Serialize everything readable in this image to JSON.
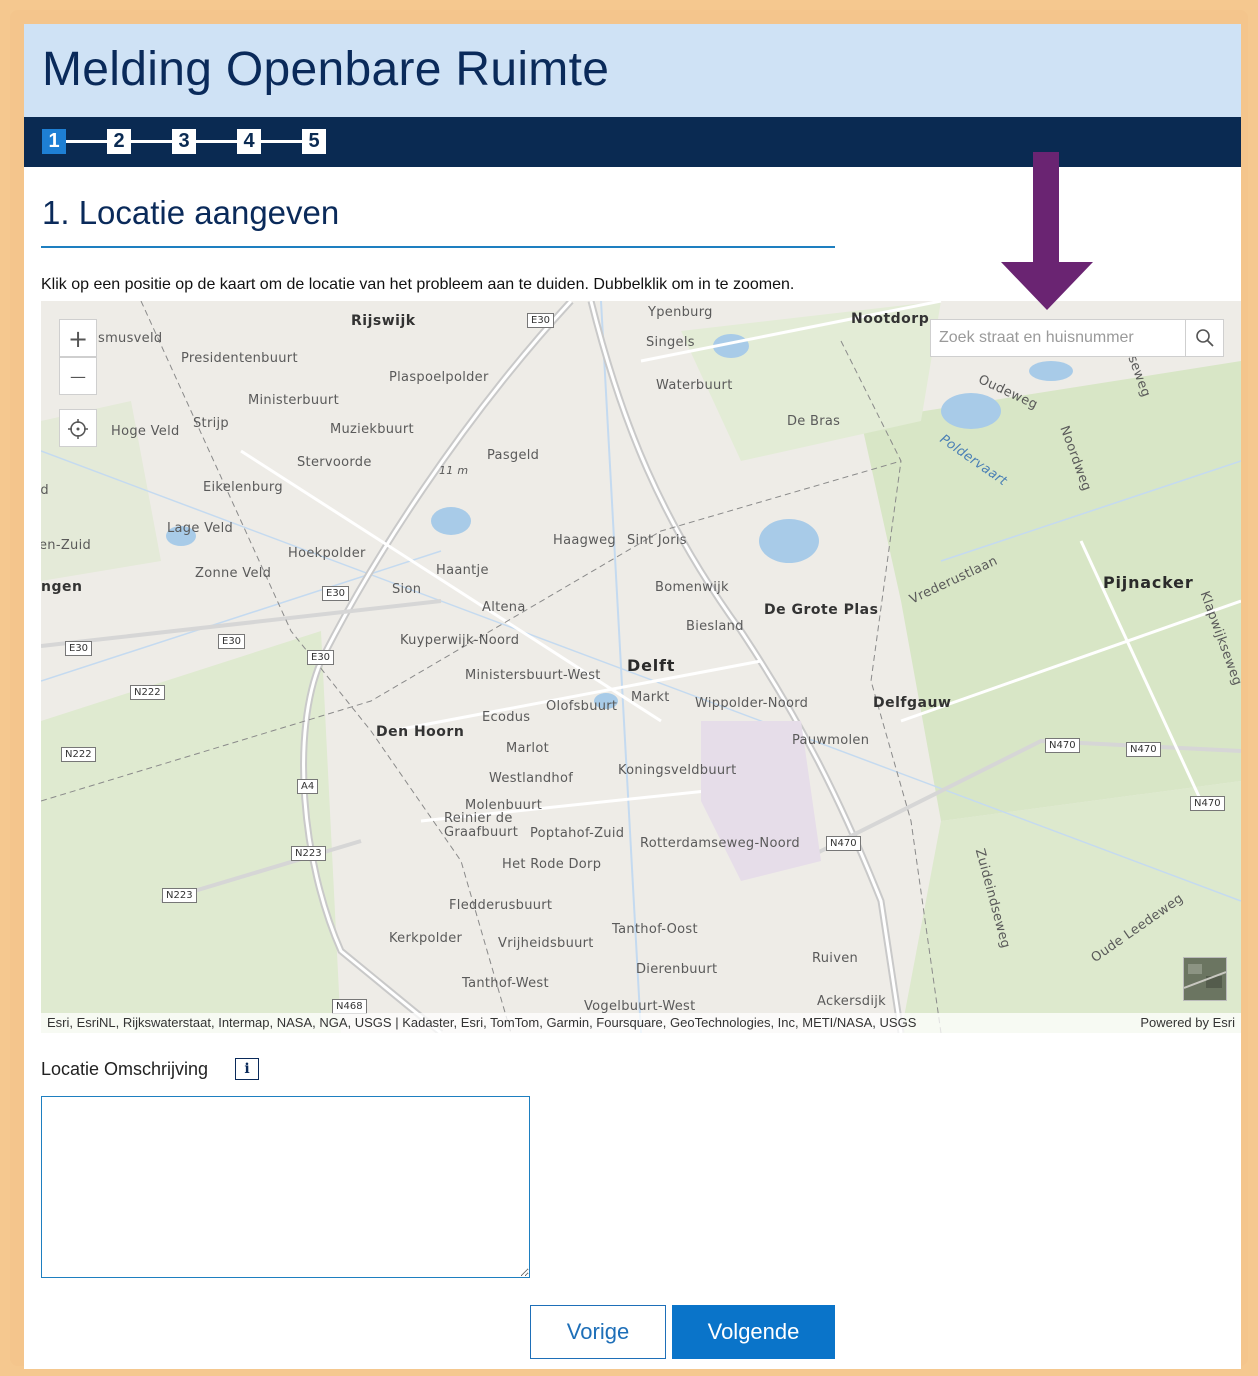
{
  "header": {
    "title": "Melding Openbare Ruimte"
  },
  "steps": [
    {
      "label": "1",
      "active": true
    },
    {
      "label": "2",
      "active": false
    },
    {
      "label": "3",
      "active": false
    },
    {
      "label": "4",
      "active": false
    },
    {
      "label": "5",
      "active": false
    }
  ],
  "section": {
    "title": "1. Locatie aangeven",
    "instruction": "Klik op een positie op de kaart om de locatie van het probleem aan te duiden. Dubbelklik om in te zoomen."
  },
  "map": {
    "zoom_in_label": "+",
    "zoom_out_label": "—",
    "search": {
      "placeholder": "Zoek straat en huisnummer",
      "value": ""
    },
    "attribution_left": "Esri, EsriNL, Rijkswaterstaat, Intermap, NASA, NGA, USGS | Kadaster, Esri, TomTom, Garmin, Foursquare, GeoTechnologies, Inc, METI/NASA, USGS",
    "attribution_right": "Powered by Esri",
    "places": {
      "rijswijk": "Rijswijk",
      "ypenburg": "Ypenburg",
      "nootdorp": "Nootdorp",
      "smusveld": "smusveld",
      "presidentenbuurt": "Presidentenbuurt",
      "singels": "Singels",
      "plaspoelpolder": "Plaspoelpolder",
      "waterbuurt": "Waterbuurt",
      "ministerbuurt": "Ministerbuurt",
      "oudeweg": "Oudeweg",
      "hoge_veld": "Hoge Veld",
      "strijp": "Strijp",
      "muziekbuurt": "Muziekbuurt",
      "de_bras": "De Bras",
      "noordweg": "Noordweg",
      "opseweg": "opseweg",
      "poldervaart": "Poldervaart",
      "stervoorde": "Stervoorde",
      "pasgeld": "Pasgeld",
      "elev": "11 m",
      "d": "rd",
      "eikelenburg": "Eikelenburg",
      "lage_veld": "Lage Veld",
      "zuid": "en-Zuid",
      "hoekpolder": "Hoekpolder",
      "haagweg": "Haagweg",
      "sint_joris": "Sint Joris",
      "zonne_veld": "Zonne Veld",
      "haantje": "Haantje",
      "ngen": "ngen",
      "sion": "Sion",
      "bomenwijk": "Bomenwijk",
      "vrederustlaan": "Vrederustlaan",
      "pijnacker": "Pijnacker",
      "altena": "Altena",
      "de_grote_plas": "De Grote Plas",
      "klapwijkseweg": "Klapwijkseweg",
      "biesland": "Biesland",
      "kuyperwijk": "Kuyperwijk-Noord",
      "delft": "Delft",
      "ministersbuurt_west": "Ministersbuurt-West",
      "markt": "Markt",
      "olofsbuurt": "Olofsbuurt",
      "wippolder": "Wippolder-Noord",
      "delfgauw": "Delfgauw",
      "ecodus": "Ecodus",
      "den_hoorn": "Den Hoorn",
      "pauwmolen": "Pauwmolen",
      "marlot": "Marlot",
      "westlandhof": "Westlandhof",
      "koningsveldbuurt": "Koningsveldbuurt",
      "molenbuurt": "Molenbuurt",
      "reinier": "Reinier de",
      "graafbuurt": "Graafbuurt",
      "poptahof": "Poptahof-Zuid",
      "rotterdamseweg": "Rotterdamseweg-Noord",
      "zuideindseweg": "Zuideindseweg",
      "het_rode_dorp": "Het Rode Dorp",
      "fledderusbuurt": "Fledderusbuurt",
      "oude_leedeweg": "Oude Leedeweg",
      "tanthof_oost": "Tanthof-Oost",
      "kerkpolder": "Kerkpolder",
      "vrijheidsbuurt": "Vrijheidsbuurt",
      "ruiven": "Ruiven",
      "dierenbuurt": "Dierenbuurt",
      "tanthof_west": "Tanthof-West",
      "ackersdijk": "Ackersdijk",
      "vogelbuurt_west": "Vogelbuurt-West"
    },
    "roads": {
      "e30": "E30",
      "n222": "N222",
      "a4": "A4",
      "n223": "N223",
      "n470": "N470",
      "n468": "N468"
    }
  },
  "description": {
    "label": "Locatie Omschrijving",
    "info_icon": "i",
    "value": ""
  },
  "buttons": {
    "prev": "Vorige",
    "next": "Volgende"
  },
  "colors": {
    "header_bg": "#cfe2f5",
    "stepbar_bg": "#0a2a52",
    "accent": "#0a74c9",
    "arrow": "#6a2472",
    "frame": "#f4c58c"
  }
}
